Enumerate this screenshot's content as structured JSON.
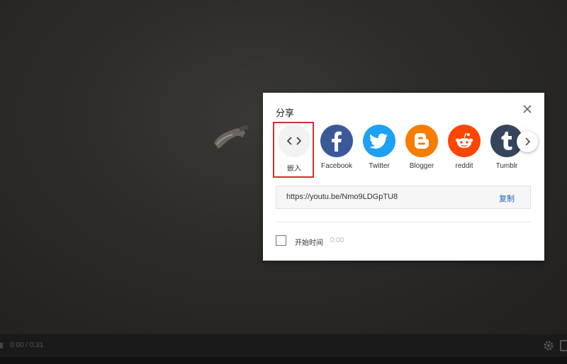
{
  "player": {
    "time": "0:00 / 0:31"
  },
  "share_dialog": {
    "title": "分享",
    "items": [
      {
        "label": "嵌入",
        "icon": "embed-icon",
        "color": "#f2f2f2"
      },
      {
        "label": "Facebook",
        "icon": "facebook-icon",
        "color": "#3b5998"
      },
      {
        "label": "Twitter",
        "icon": "twitter-icon",
        "color": "#1da1f2"
      },
      {
        "label": "Blogger",
        "icon": "blogger-icon",
        "color": "#f57d00"
      },
      {
        "label": "reddit",
        "icon": "reddit-icon",
        "color": "#ff4500"
      },
      {
        "label": "Tumblr",
        "icon": "tumblr-icon",
        "color": "#35465c"
      }
    ],
    "url": "https://youtu.be/Nmo9LDGpTU8",
    "copy_label": "复制",
    "start_time_label": "开始时间",
    "start_time_value": "0:00",
    "start_time_checked": false
  }
}
